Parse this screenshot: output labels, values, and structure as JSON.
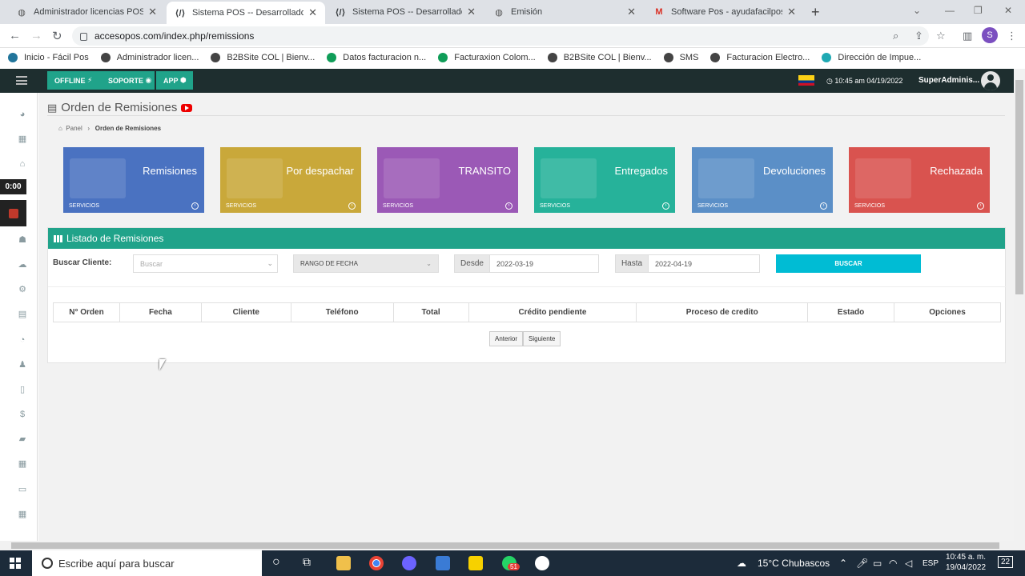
{
  "browser": {
    "tabs": [
      {
        "title": "Administrador licencias POS",
        "icon": "globe-icon"
      },
      {
        "title": "Sistema POS -- Desarrollado por",
        "icon": "code-icon"
      },
      {
        "title": "Sistema POS -- Desarrollado por",
        "icon": "code-icon"
      },
      {
        "title": "Emisión",
        "icon": "globe-icon"
      },
      {
        "title": "Software Pos - ayudafacilpos@gr",
        "icon": "gmail-icon"
      }
    ],
    "url": "accesopos.com/index.php/remissions",
    "profile_initial": "S",
    "bookmarks": [
      {
        "label": "Inicio - Fácil Pos",
        "icon": "wordpress-icon",
        "color": "#21759b"
      },
      {
        "label": "Administrador licen...",
        "icon": "globe-icon",
        "color": "#444"
      },
      {
        "label": "B2BSite COL | Bienv...",
        "icon": "globe-icon",
        "color": "#444"
      },
      {
        "label": "Datos facturacion n...",
        "icon": "sheets-icon",
        "color": "#0f9d58"
      },
      {
        "label": "Facturaxion Colom...",
        "icon": "sheets-icon",
        "color": "#0f9d58"
      },
      {
        "label": "B2BSite COL | Bienv...",
        "icon": "globe-icon",
        "color": "#444"
      },
      {
        "label": "SMS",
        "icon": "globe-icon",
        "color": "#444"
      },
      {
        "label": "Facturacion Electro...",
        "icon": "globe-icon",
        "color": "#444"
      },
      {
        "label": "Dirección de Impue...",
        "icon": "dian-icon",
        "color": "#1fa9b3"
      }
    ]
  },
  "header": {
    "offline": "OFFLINE",
    "soporte": "SOPORTE",
    "app": "APP",
    "datetime": "10:45 am 04/19/2022",
    "user": "SuperAdminis..."
  },
  "recorder": {
    "time": "0:00"
  },
  "page": {
    "title": "Orden de Remisiones",
    "breadcrumb_home": "Panel",
    "breadcrumb_current": "Orden de Remisiones"
  },
  "tiles": [
    {
      "label": "Remisiones",
      "sub": "SERVICIOS",
      "color": "#4a72c1"
    },
    {
      "label": "Por despachar",
      "sub": "SERVICIOS",
      "color": "#c9a83a"
    },
    {
      "label": "TRANSITO",
      "sub": "SERVICIOS",
      "color": "#9b59b6"
    },
    {
      "label": "Entregados",
      "sub": "SERVICIOS",
      "color": "#26b29a"
    },
    {
      "label": "Devoluciones",
      "sub": "SERVICIOS",
      "color": "#5b8fc7"
    },
    {
      "label": "Rechazada",
      "sub": "SERVICIOS",
      "color": "#d9534f"
    }
  ],
  "list": {
    "title": "Listado de Remisiones",
    "buscar_cliente_label": "Buscar Cliente:",
    "buscar_placeholder": "Buscar",
    "rango": "RANGO DE FECHA",
    "desde_label": "Desde",
    "desde_value": "2022-03-19",
    "hasta_label": "Hasta",
    "hasta_value": "2022-04-19",
    "buscar_btn": "BUSCAR",
    "columns": [
      "N° Orden",
      "Fecha",
      "Cliente",
      "Teléfono",
      "Total",
      "Crédito pendiente",
      "Proceso de credito",
      "Estado",
      "Opciones"
    ],
    "prev": "Anterior",
    "next": "Siguiente"
  },
  "taskbar": {
    "search": "Escribe aquí para buscar",
    "weather": "15°C  Chubascos",
    "lang": "ESP",
    "time": "10:45 a. m.",
    "date": "19/04/2022",
    "notifications": "22",
    "whatsapp_badge": "51"
  }
}
